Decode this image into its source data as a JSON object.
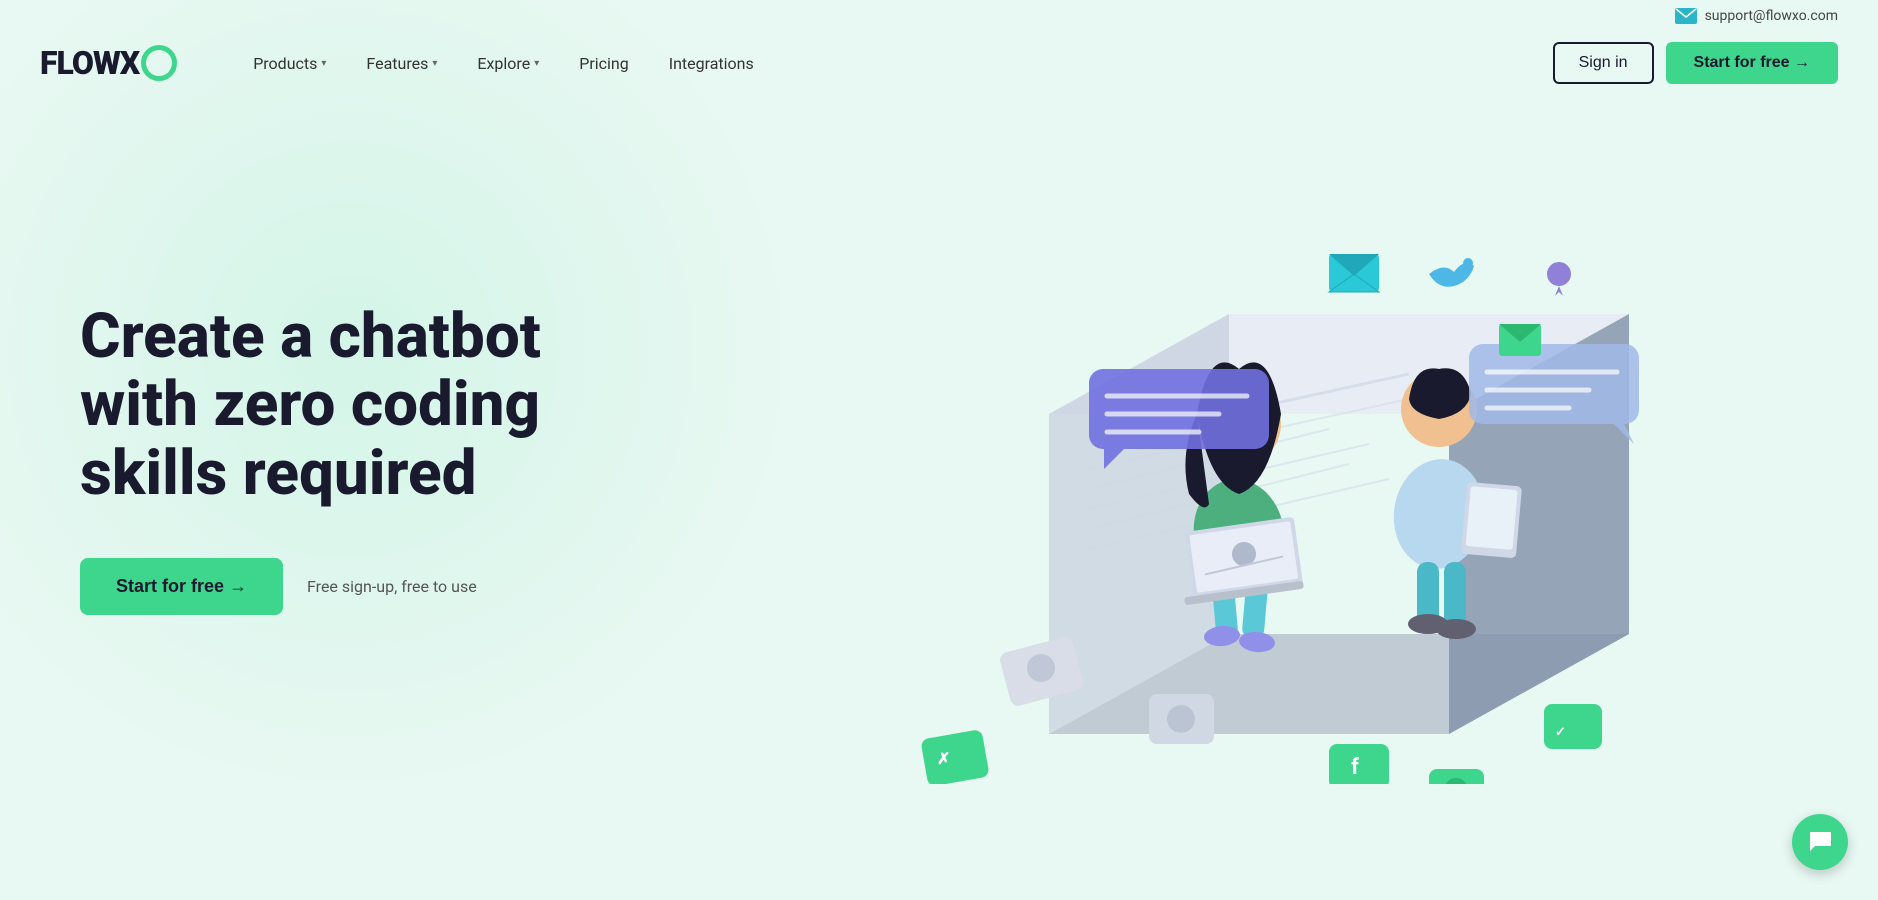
{
  "topbar": {
    "support_icon": "email-icon",
    "support_email": "support@flowxo.com"
  },
  "logo": {
    "text_flow": "FLOW",
    "text_x": "X",
    "text_o": "O"
  },
  "nav": {
    "items": [
      {
        "label": "Products",
        "has_dropdown": true
      },
      {
        "label": "Features",
        "has_dropdown": true
      },
      {
        "label": "Explore",
        "has_dropdown": true
      },
      {
        "label": "Pricing",
        "has_dropdown": false
      },
      {
        "label": "Integrations",
        "has_dropdown": false
      }
    ],
    "signin_label": "Sign in",
    "start_label": "Start for free →"
  },
  "hero": {
    "title": "Create a chatbot with zero coding skills required",
    "start_label": "Start for free →",
    "note": "Free sign-up, free to use"
  },
  "chat_fab": {
    "icon": "chat-bubble-icon"
  }
}
